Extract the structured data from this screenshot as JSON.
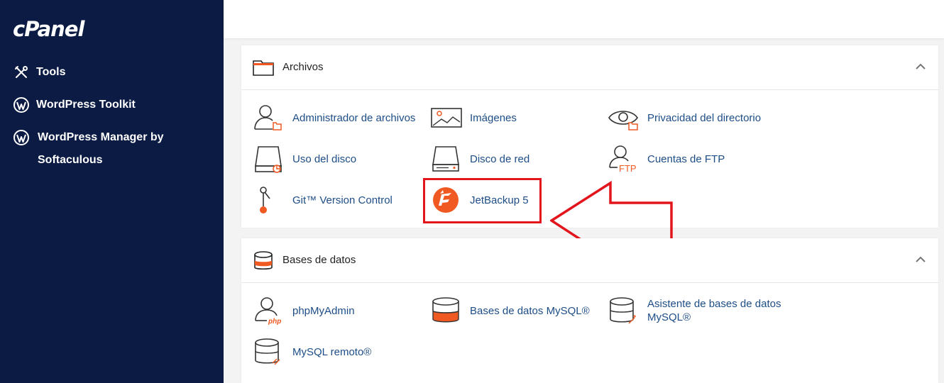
{
  "app": {
    "logo": "cPanel"
  },
  "sidebar": {
    "items": [
      {
        "label": "Tools",
        "icon": "tools-icon"
      },
      {
        "label": "WordPress Toolkit",
        "icon": "wordpress-icon"
      },
      {
        "label": "WordPress Manager by Softaculous",
        "icon": "wordpress-icon"
      }
    ]
  },
  "files": {
    "title": "Archivos",
    "items": [
      {
        "label": "Administrador de archivos",
        "icon": "file-manager-icon"
      },
      {
        "label": "Imágenes",
        "icon": "images-icon"
      },
      {
        "label": "Privacidad del directorio",
        "icon": "directory-privacy-icon"
      },
      {
        "label": "Uso del disco",
        "icon": "disk-usage-icon"
      },
      {
        "label": "Disco de red",
        "icon": "network-disk-icon"
      },
      {
        "label": "Cuentas de FTP",
        "icon": "ftp-accounts-icon",
        "badge": "FTP"
      },
      {
        "label": "Git™ Version Control",
        "icon": "git-icon"
      },
      {
        "label": "JetBackup 5",
        "icon": "jetbackup-icon"
      }
    ]
  },
  "databases": {
    "title": "Bases de datos",
    "items": [
      {
        "label": "phpMyAdmin",
        "icon": "phpmyadmin-icon",
        "badge": "php"
      },
      {
        "label": "Bases de datos MySQL®",
        "icon": "mysql-databases-icon"
      },
      {
        "label": "Asistente de bases de datos MySQL®",
        "icon": "mysql-wizard-icon"
      },
      {
        "label": "MySQL remoto®",
        "icon": "remote-mysql-icon"
      }
    ]
  },
  "colors": {
    "sidebar_bg": "#0b1b43",
    "link": "#1d4d87",
    "accent_orange": "#f05a22",
    "highlight_red": "#e2151c"
  }
}
